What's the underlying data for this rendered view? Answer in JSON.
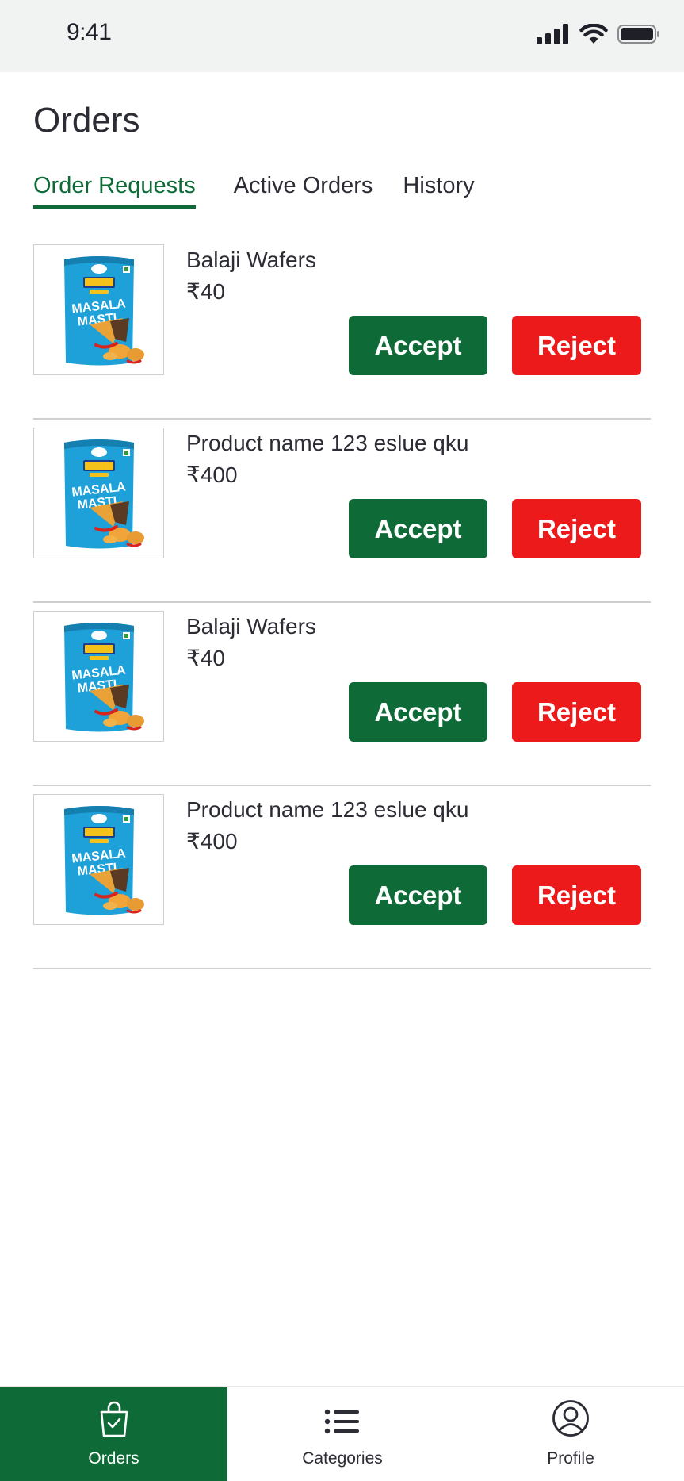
{
  "status_bar": {
    "time": "9:41"
  },
  "page": {
    "title": "Orders"
  },
  "tabs": [
    {
      "label": "Order Requests",
      "active": true
    },
    {
      "label": "Active Orders",
      "active": false
    },
    {
      "label": "History",
      "active": false
    }
  ],
  "orders": [
    {
      "name": "Balaji Wafers",
      "price": "₹40",
      "accept_label": "Accept",
      "reject_label": "Reject"
    },
    {
      "name": "Product name 123 eslue qku",
      "price": "₹400",
      "accept_label": "Accept",
      "reject_label": "Reject"
    },
    {
      "name": "Balaji Wafers",
      "price": "₹40",
      "accept_label": "Accept",
      "reject_label": "Reject"
    },
    {
      "name": "Product name 123 eslue qku",
      "price": "₹400",
      "accept_label": "Accept",
      "reject_label": "Reject"
    }
  ],
  "bottom_nav": [
    {
      "label": "Orders",
      "icon": "shopping-bag-check-icon",
      "active": true
    },
    {
      "label": "Categories",
      "icon": "list-icon",
      "active": false
    },
    {
      "label": "Profile",
      "icon": "user-circle-icon",
      "active": false
    }
  ],
  "colors": {
    "accent_green": "#0e6b37",
    "reject_red": "#ec1a1a",
    "status_bar_bg": "#f1f2f2"
  }
}
